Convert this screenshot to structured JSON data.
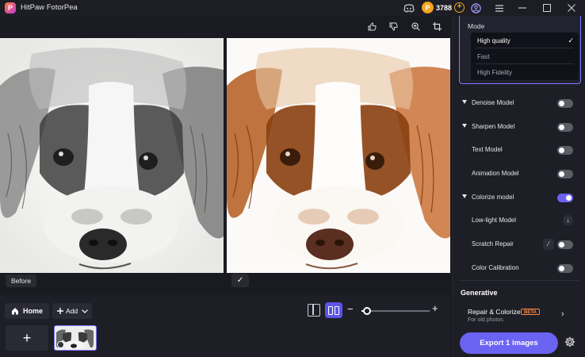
{
  "app": {
    "logo_letter": "P",
    "title": "HitPaw FotorPea"
  },
  "titlebar": {
    "credits": "3788",
    "coin_symbol": "P",
    "plus_symbol": "+",
    "icons": [
      "discord-icon",
      "user-icon",
      "menu-icon",
      "minimize-icon",
      "maximize-icon",
      "close-icon"
    ]
  },
  "preview_toolbar": {
    "icons": [
      "thumbs-up-icon",
      "thumbs-down-icon",
      "zoom-in-icon",
      "crop-icon"
    ]
  },
  "canvas": {
    "before_label": "Before",
    "check_symbol": "✓"
  },
  "bottom": {
    "home_label": "Home",
    "add_label": "Add",
    "new_symbol": "+",
    "zoom_level": 0.08
  },
  "panel": {
    "mode": {
      "title": "Mode",
      "options": [
        "High quality",
        "Fast",
        "High Fidelity"
      ],
      "selected": "High quality"
    },
    "models": [
      {
        "label": "Denoise Model",
        "expandable": true,
        "control": "toggle",
        "on": false
      },
      {
        "label": "Sharpen Model",
        "expandable": true,
        "control": "toggle",
        "on": false
      },
      {
        "label": "Text Model",
        "expandable": false,
        "control": "toggle",
        "on": false
      },
      {
        "label": "Animation Model",
        "expandable": false,
        "control": "toggle",
        "on": false
      },
      {
        "label": "Colorize model",
        "expandable": true,
        "control": "toggle",
        "on": true
      },
      {
        "label": "Low-light Model",
        "expandable": false,
        "control": "download"
      },
      {
        "label": "Scratch Repair",
        "expandable": false,
        "control": "toggle",
        "on": false,
        "extra_icon": "magic-wand-icon"
      },
      {
        "label": "Color Calibration",
        "expandable": false,
        "control": "toggle",
        "on": false
      }
    ],
    "generative": {
      "title": "Generative",
      "item_title": "Repair & Colorize",
      "badge": "BETA",
      "item_subtitle": "For old photos"
    },
    "export_label": "Export 1 images",
    "accent_color": "#6b63f2"
  }
}
